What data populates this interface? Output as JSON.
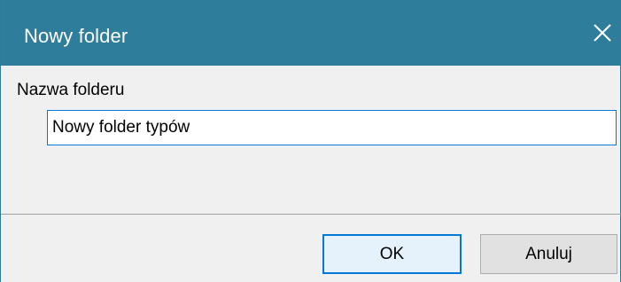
{
  "dialog": {
    "title": "Nowy folder",
    "close_icon": "close-icon",
    "accent_color": "#2e7d9b"
  },
  "form": {
    "folder_name_label": "Nazwa folderu",
    "folder_name_value": "Nowy folder typów"
  },
  "buttons": {
    "ok_label": "OK",
    "cancel_label": "Anuluj"
  }
}
